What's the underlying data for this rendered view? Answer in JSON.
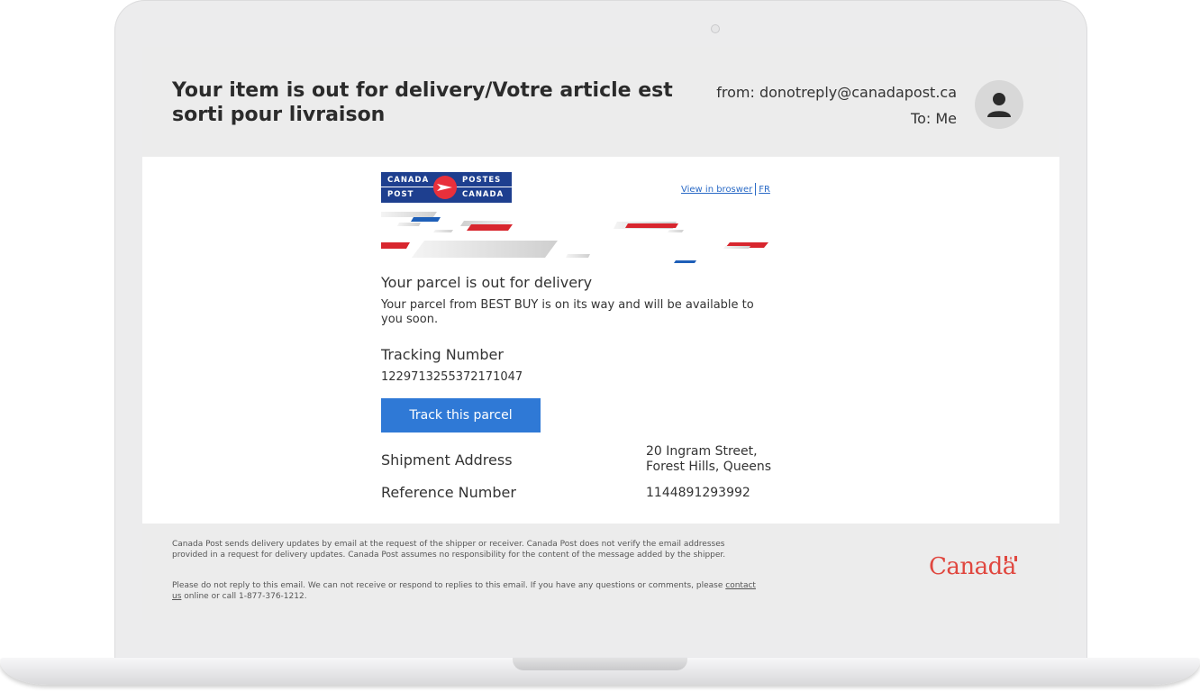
{
  "email": {
    "subject": "Your item is out for delivery/Votre article est sorti pour livraison",
    "from": "from: donotreply@canadapost.ca",
    "to": "To: Me"
  },
  "logo": {
    "canada": "CANADA",
    "postes": "POSTES",
    "post": "POST",
    "canada2": "CANADA"
  },
  "links": {
    "view_in_browser": "View in broswer",
    "fr": "FR"
  },
  "body": {
    "title": "Your parcel is out for delivery",
    "description": "Your parcel from BEST BUY is on its way and will be available to you soon.",
    "tracking_label": "Tracking Number",
    "tracking_number": "1229713255372171047",
    "track_button": "Track this parcel",
    "shipment_label": "Shipment Address",
    "shipment_line1": "20 Ingram Street,",
    "shipment_line2": "Forest Hills, Queens",
    "reference_label": "Reference Number",
    "reference_number": "1144891293992"
  },
  "footer": {
    "p1": "Canada Post sends delivery updates by email at the request of the shipper or receiver. Canada Post does not verify the email addresses provided in a request for delivery updates. Canada Post assumes no responsibility for the content of the message added by the shipper.",
    "p2_before": "Please do not reply to this email. We can not receive or respond to replies to this email. If you have any questions or comments, please ",
    "p2_link": "contact us",
    "p2_after": " online or call 1-877-376-1212.",
    "wordmark": "Canada"
  },
  "colors": {
    "brand_blue": "#1e3f8f",
    "brand_red": "#e8303b",
    "button_blue": "#2f79d6",
    "wordmark_red": "#e0473f"
  }
}
